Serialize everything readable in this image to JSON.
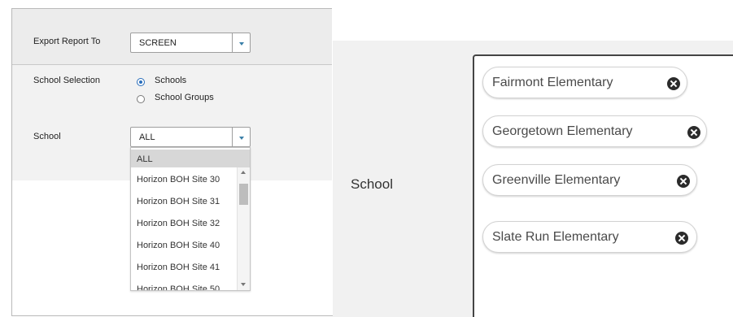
{
  "export": {
    "label": "Export Report To",
    "value": "SCREEN"
  },
  "school_selection": {
    "label": "School Selection",
    "options": [
      {
        "label": "Schools",
        "selected": true
      },
      {
        "label": "School Groups",
        "selected": false
      }
    ]
  },
  "school": {
    "label": "School",
    "value": "ALL",
    "dropdown_items": [
      "ALL",
      "Horizon BOH Site 30",
      "Horizon BOH Site 31",
      "Horizon BOH Site 32",
      "Horizon BOH Site 40",
      "Horizon BOH Site 41",
      "Horizon BOH Site 50"
    ]
  },
  "right_panel": {
    "label": "School",
    "tags": [
      "Fairmont Elementary",
      "Georgetown Elementary",
      "Greenville Elementary",
      "Slate Run Elementary"
    ]
  },
  "colors": {
    "radio_selected": "#2a6ebb",
    "caret": "#3a7fa8",
    "tag_remove": "#2b2b2b"
  },
  "icons": {
    "caret": "chevron-down-icon",
    "remove": "close-circle-icon",
    "scroll_up": "arrow-up-icon",
    "scroll_down": "arrow-down-icon"
  }
}
